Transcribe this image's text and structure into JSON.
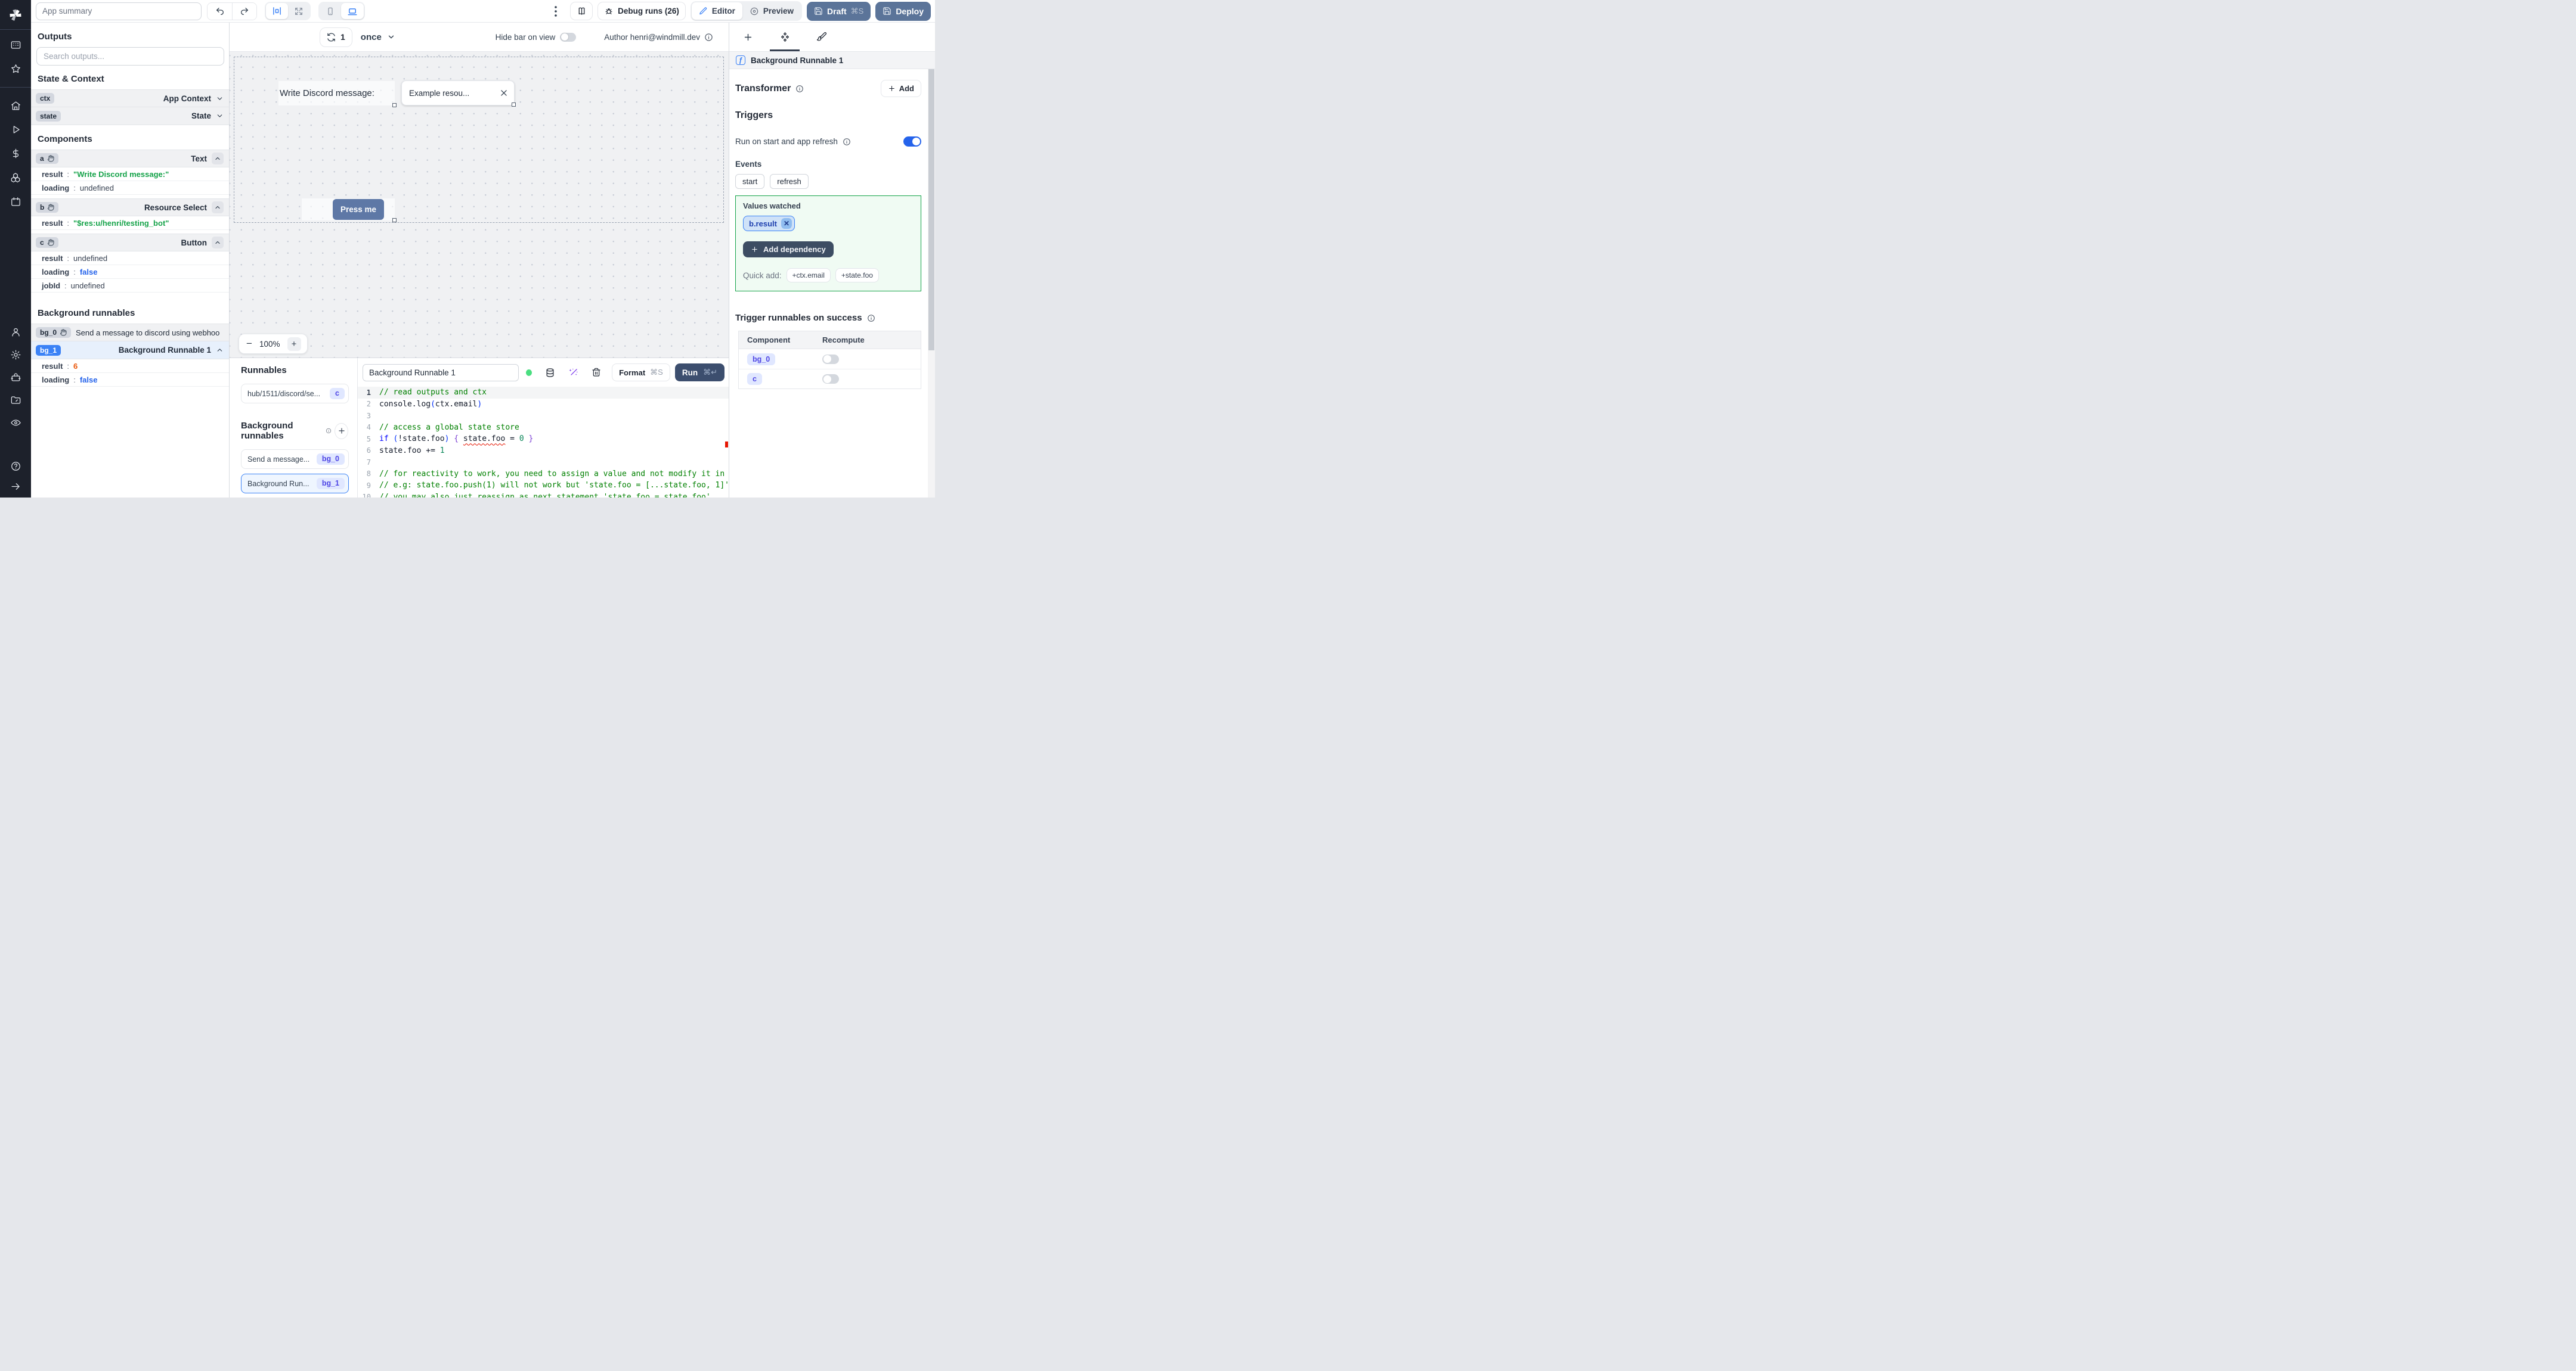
{
  "colors": {
    "accent_blue": "#2563eb",
    "brand_slate_button": "#5b7499",
    "run_button": "#3c4e6e",
    "success_green": "#16a34a",
    "string_green": "#16a34a",
    "bool_blue": "#2563eb",
    "number_orange": "#ea580c",
    "badge_indigo_bg": "#e0e7ff",
    "sidebar_dark": "#1d212b"
  },
  "header": {
    "app_summary": "App summary",
    "debug_runs": "Debug runs (26)",
    "editor": "Editor",
    "preview": "Preview",
    "draft": "Draft",
    "draft_shortcut": "⌘S",
    "deploy": "Deploy"
  },
  "canvas_toolbar": {
    "refresh_count": "1",
    "schedule_mode": "once",
    "hide_bar_label": "Hide bar on view",
    "author": "Author henri@windmill.dev"
  },
  "canvas": {
    "text_component_value": "Write Discord message:",
    "select_value": "Example resou...",
    "select_clear": "✕",
    "button_label": "Press me",
    "zoom_out": "−",
    "zoom_level": "100%",
    "zoom_in": "+"
  },
  "outputs": {
    "title": "Outputs",
    "search_placeholder": "Search outputs...",
    "sections": {
      "state_context": "State & Context",
      "components": "Components",
      "background_runnables": "Background runnables"
    },
    "ctx_id": "ctx",
    "ctx_type": "App Context",
    "state_id": "state",
    "state_type": "State",
    "a_id": "a",
    "a_type": "Text",
    "a_rows": [
      {
        "key": "result",
        "value": "\"Write Discord message:\""
      },
      {
        "key": "loading",
        "value": "undefined"
      }
    ],
    "b_id": "b",
    "b_type": "Resource Select",
    "b_rows": [
      {
        "key": "result",
        "value": "\"$res:u/henri/testing_bot\""
      }
    ],
    "c_id": "c",
    "c_type": "Button",
    "c_rows": [
      {
        "key": "result",
        "value": "undefined"
      },
      {
        "key": "loading",
        "value": "false"
      },
      {
        "key": "jobId",
        "value": "undefined"
      }
    ],
    "bg0_id": "bg_0",
    "bg0_label": "Send a message to discord using webhoo",
    "bg1_id": "bg_1",
    "bg1_type": "Background Runnable 1",
    "bg1_rows": [
      {
        "key": "result",
        "value": "6"
      },
      {
        "key": "loading",
        "value": "false"
      }
    ]
  },
  "runnables": {
    "title": "Runnables",
    "hub_label": "hub/1511/discord/se...",
    "hub_badge": "c",
    "bg_title": "Background runnables",
    "item0_label": "Send a message...",
    "item0_badge": "bg_0",
    "item1_label": "Background Run...",
    "item1_badge": "bg_1"
  },
  "editor": {
    "name": "Background Runnable 1",
    "format": "Format",
    "format_shortcut": "⌘S",
    "run": "Run",
    "run_shortcut": "⌘↵",
    "code_lines": [
      {
        "n": "1",
        "segs": [
          [
            "// read outputs and ctx",
            "comment"
          ]
        ]
      },
      {
        "n": "2",
        "segs": [
          [
            "console.log",
            "plain"
          ],
          [
            "(",
            "paren"
          ],
          [
            "ctx.email",
            "plain"
          ],
          [
            ")",
            "paren"
          ]
        ]
      },
      {
        "n": "3",
        "segs": []
      },
      {
        "n": "4",
        "segs": [
          [
            "// access a global state store",
            "comment"
          ]
        ]
      },
      {
        "n": "5",
        "segs": [
          [
            "if ",
            "kw"
          ],
          [
            "(",
            "paren"
          ],
          [
            "!state.foo",
            "plain"
          ],
          [
            ") ",
            "paren"
          ],
          [
            "{ ",
            "brace"
          ],
          [
            "state.foo",
            "err"
          ],
          [
            " = ",
            "plain"
          ],
          [
            "0",
            "num"
          ],
          [
            " }",
            "brace"
          ]
        ]
      },
      {
        "n": "6",
        "segs": [
          [
            "state.foo += ",
            "plain"
          ],
          [
            "1",
            "num"
          ]
        ]
      },
      {
        "n": "7",
        "segs": []
      },
      {
        "n": "8",
        "segs": [
          [
            "// for reactivity to work, you need to assign a value and not modify it in place",
            "comment"
          ]
        ]
      },
      {
        "n": "9",
        "segs": [
          [
            "// e.g: state.foo.push(1) will not work but 'state.foo = [...state.foo, 1]'",
            "comment"
          ]
        ]
      },
      {
        "n": "10",
        "segs": [
          [
            "// you may also just reassign as next statement 'state.foo = state.foo'",
            "comment"
          ]
        ]
      }
    ]
  },
  "right_panel": {
    "selected_runnable": "Background Runnable 1",
    "transformer": "Transformer",
    "add": "Add",
    "triggers": "Triggers",
    "run_on_start": "Run on start and app refresh",
    "events": "Events",
    "event_start": "start",
    "event_refresh": "refresh",
    "values_watched": "Values watched",
    "watched_chip": "b.result",
    "watched_chip_close": "✕",
    "add_dependency": "Add dependency",
    "quick_add": "Quick add:",
    "quick_chip_ctx": "+ctx.email",
    "quick_chip_state": "+state.foo",
    "trigger_success": "Trigger runnables on success",
    "col_component": "Component",
    "col_recompute": "Recompute",
    "row0_component": "bg_0",
    "row1_component": "c"
  }
}
